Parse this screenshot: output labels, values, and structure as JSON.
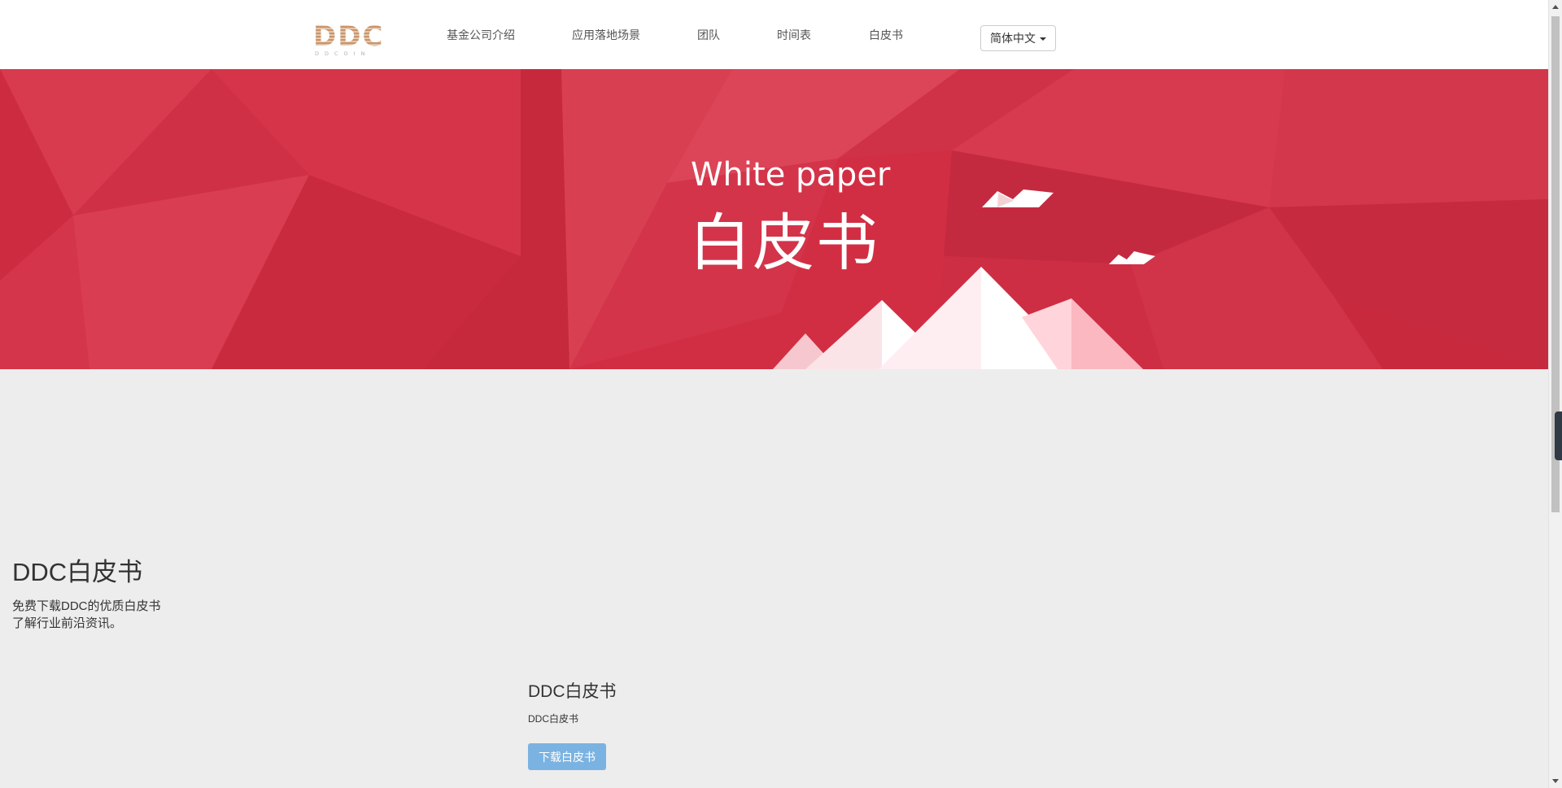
{
  "header": {
    "logo_text": "DDC",
    "logo_subtext": "DDCOIN",
    "nav": [
      {
        "label": "基金公司介绍"
      },
      {
        "label": "应用落地场景"
      },
      {
        "label": "团队"
      },
      {
        "label": "时间表"
      },
      {
        "label": "白皮书"
      }
    ],
    "language_label": "简体中文"
  },
  "banner": {
    "title_en": "White paper",
    "title_cn": "白皮书"
  },
  "content": {
    "title": "DDC白皮书",
    "desc_line1": "免费下载DDC的优质白皮书",
    "desc_line2": "了解行业前沿资讯。"
  },
  "card": {
    "title": "DDC白皮书",
    "subtitle": "DDC白皮书",
    "download_label": "下载白皮书"
  },
  "colors": {
    "banner_red": "#d22e43",
    "button_blue": "#7ab3e2",
    "logo_gold": "#c9956a"
  },
  "icons": [
    "chevron-down-icon",
    "mountain-illustration",
    "bird-icon"
  ]
}
